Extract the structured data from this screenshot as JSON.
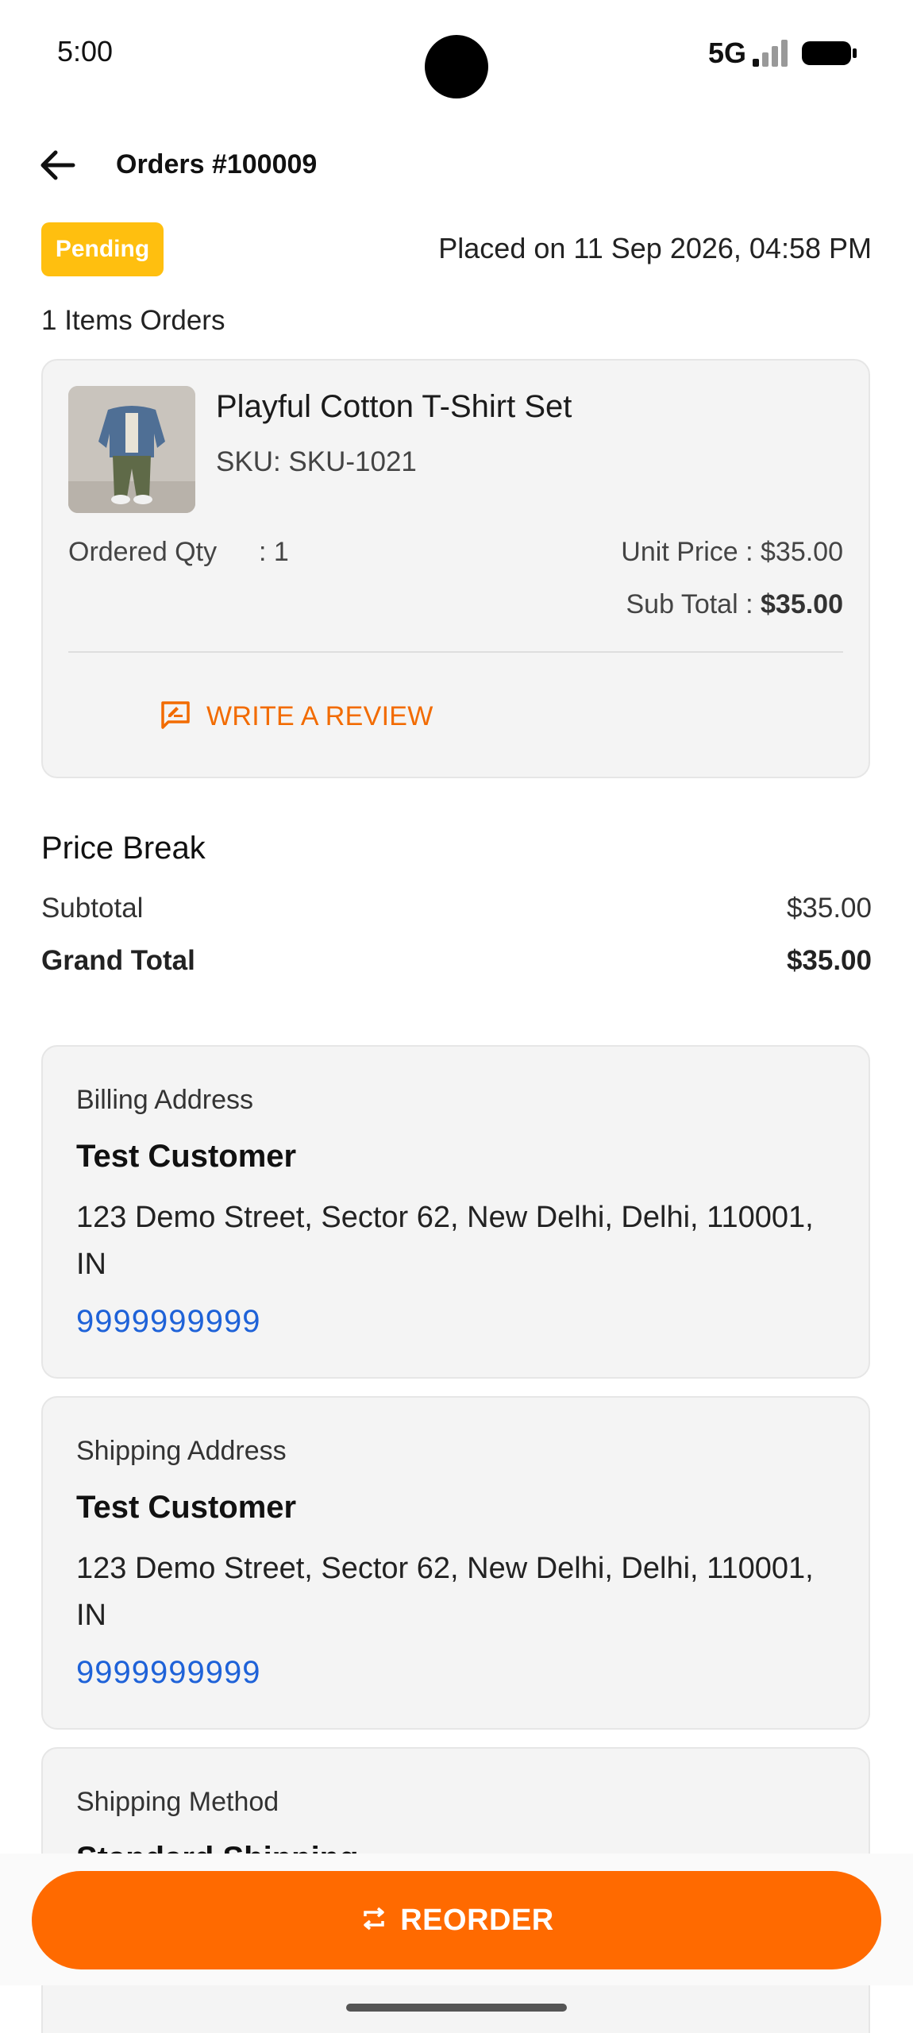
{
  "status_bar": {
    "time": "5:00",
    "network": "5G"
  },
  "header": {
    "back_icon": "arrow-left-icon",
    "title": "Orders #100009"
  },
  "order": {
    "status": "Pending",
    "status_color": "#ffbf0f",
    "placed_on": "Placed on 11 Sep 2026, 04:58 PM",
    "items_count_label": "1 Items Orders"
  },
  "item": {
    "name": "Playful Cotton T-Shirt Set",
    "sku": "SKU: SKU-1021",
    "qty_label": "Ordered Qty",
    "qty_value": ": 1",
    "unit_price": "Unit Price : $35.00",
    "sub_total_label": "Sub Total : ",
    "sub_total_value": "$35.00",
    "review_label": "WRITE A REVIEW",
    "review_icon": "rate-review-icon",
    "accent_color": "#f26b00"
  },
  "price_break": {
    "title": "Price Break",
    "subtotal_label": "Subtotal",
    "subtotal_value": "$35.00",
    "grand_total_label": "Grand Total",
    "grand_total_value": "$35.00"
  },
  "billing": {
    "label": "Billing Address",
    "name": "Test Customer",
    "address": "123 Demo Street, Sector 62, New Delhi, Delhi, 110001, IN",
    "phone": "9999999999"
  },
  "shipping": {
    "label": "Shipping Address",
    "name": "Test Customer",
    "address": "123 Demo Street, Sector 62, New Delhi, Delhi, 110001, IN",
    "phone": "9999999999"
  },
  "shipping_method": {
    "label": "Shipping Method",
    "value": "Standard Shipping"
  },
  "footer": {
    "reorder_label": "REORDER",
    "reorder_icon": "repeat-icon",
    "brand_color": "#ff6a00"
  }
}
